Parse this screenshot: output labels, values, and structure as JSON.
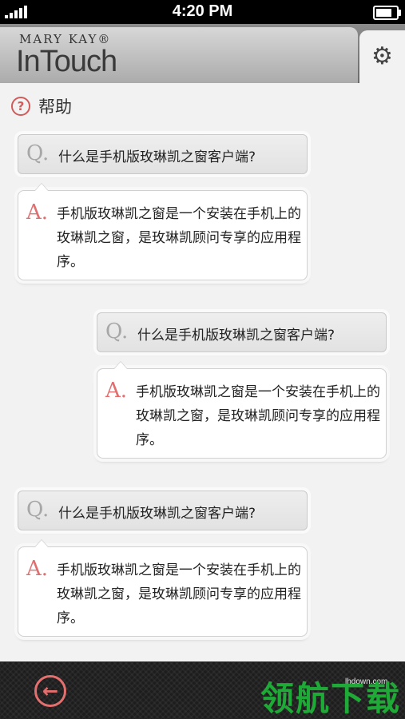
{
  "status_bar": {
    "time": "4:20 PM",
    "battery_level": 0.95
  },
  "header": {
    "brand_top": "MARY KAY®",
    "brand_main": "InTouch",
    "settings_icon": "gear-icon"
  },
  "page": {
    "title": "帮助",
    "title_icon": "help-circle-icon"
  },
  "faq": [
    {
      "q_letter": "Q.",
      "question": "什么是手机版玫琳凯之窗客户端?",
      "a_letter": "A.",
      "answer": "手机版玫琳凯之窗是一个安装在手机上的玫琳凯之窗，是玫琳凯顾问专享的应用程序。"
    },
    {
      "q_letter": "Q.",
      "question": "什么是手机版玫琳凯之窗客户端?",
      "a_letter": "A.",
      "answer": "手机版玫琳凯之窗是一个安装在手机上的玫琳凯之窗，是玫琳凯顾问专享的应用程序。"
    },
    {
      "q_letter": "Q.",
      "question": "什么是手机版玫琳凯之窗客户端?",
      "a_letter": "A.",
      "answer": "手机版玫琳凯之窗是一个安装在手机上的玫琳凯之窗，是玫琳凯顾问专享的应用程序。"
    }
  ],
  "bottom_bar": {
    "back_icon": "back-arrow-icon"
  },
  "watermark": {
    "url": "lhdown.com",
    "text": "领航下载"
  },
  "colors": {
    "accent": "#e36f6f",
    "watermark": "#1faa37"
  }
}
